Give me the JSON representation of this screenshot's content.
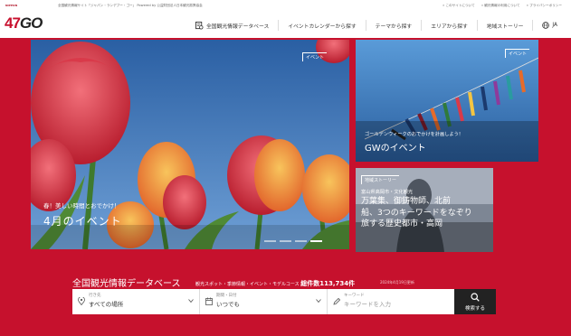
{
  "header": {
    "logo_small": "NIPPON",
    "logo_mark": "47",
    "logo_text": "GO",
    "tagline": "全国観光情報サイト「ジャパン・ランデブー・ゴー」 Powered by 公益財団法人日本観光振興協会",
    "toplinks": [
      "» このサイトについて",
      "» 観光情報の利用について",
      "» プライバシーポリシー"
    ],
    "nav": {
      "database": "全国観光情報データベース",
      "calendar": "イベントカレンダーから探す",
      "theme": "テーマから探す",
      "area": "エリアから探す",
      "story": "地域ストーリー",
      "lang": "JA"
    }
  },
  "hero": {
    "tag": "イベント",
    "subtitle": "春！美しい時間とおでかけ！",
    "title": "4月のイベント"
  },
  "card_gw": {
    "tag": "イベント",
    "subtitle": "ゴールデンウィークのおでかけを計画しよう！",
    "title": "GWのイベント"
  },
  "card_story": {
    "tag": "地域ストーリー",
    "subtitle": "富山県高岡市・文化観光",
    "lines": [
      "万葉集、御鋳物師、北前",
      "船、3つのキーワードをなぞり",
      "旅する歴史都市・高岡"
    ]
  },
  "search": {
    "title": "全国観光情報データベース",
    "info_prefix": "観光スポット・季節情報・イベント・モデルコース",
    "count_label": "総件数113,734件",
    "date": "2024年4月19日更新",
    "place_label": "行き先",
    "place_value": "すべての場所",
    "when_label": "期間・日付",
    "when_value": "いつでも",
    "keyword_label": "キーワード",
    "keyword_placeholder": "キーワードを入力",
    "button": "検索する"
  },
  "colors": {
    "brand_red": "#c6112d",
    "search_button": "#222222"
  }
}
